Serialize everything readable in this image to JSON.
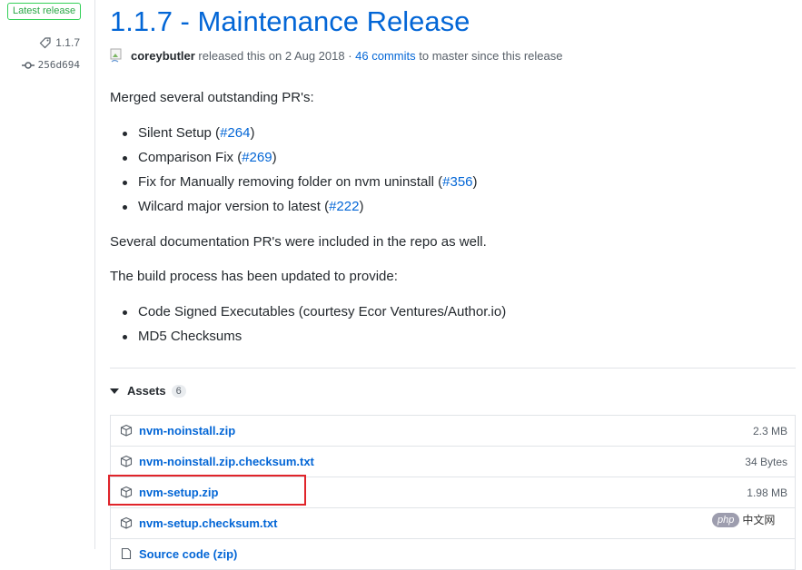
{
  "sidebar": {
    "badge": "Latest release",
    "tag": "1.1.7",
    "commit": "256d694"
  },
  "release": {
    "title": "1.1.7 - Maintenance Release",
    "author": "coreybutler",
    "released_text": " released this on 2 Aug 2018 · ",
    "commits_link": "46 commits",
    "since_text": " to master since this release"
  },
  "notes": {
    "intro": "Merged several outstanding PR's:",
    "prs": [
      {
        "text": "Silent Setup (",
        "link": "#264",
        "tail": ")"
      },
      {
        "text": "Comparison Fix (",
        "link": "#269",
        "tail": ")"
      },
      {
        "text": "Fix for Manually removing folder on nvm uninstall (",
        "link": "#356",
        "tail": ")"
      },
      {
        "text": "Wilcard major version to latest (",
        "link": "#222",
        "tail": ")"
      }
    ],
    "docs": "Several documentation PR's were included in the repo as well.",
    "build_intro": "The build process has been updated to provide:",
    "build_items": [
      "Code Signed Executables (courtesy Ecor Ventures/Author.io)",
      "MD5 Checksums"
    ]
  },
  "assets": {
    "label": "Assets",
    "count": "6",
    "items": [
      {
        "name": "nvm-noinstall.zip",
        "size": "2.3 MB"
      },
      {
        "name": "nvm-noinstall.zip.checksum.txt",
        "size": "34 Bytes"
      },
      {
        "name": "nvm-setup.zip",
        "size": "1.98 MB"
      },
      {
        "name": "nvm-setup.checksum.txt",
        "size": ""
      },
      {
        "name": "Source code (zip)",
        "size": ""
      }
    ]
  },
  "watermark": {
    "logo": "php",
    "text": "中文网"
  },
  "colors": {
    "link": "#0366d6",
    "highlight": "#e0242a",
    "badge": "#28a745"
  }
}
